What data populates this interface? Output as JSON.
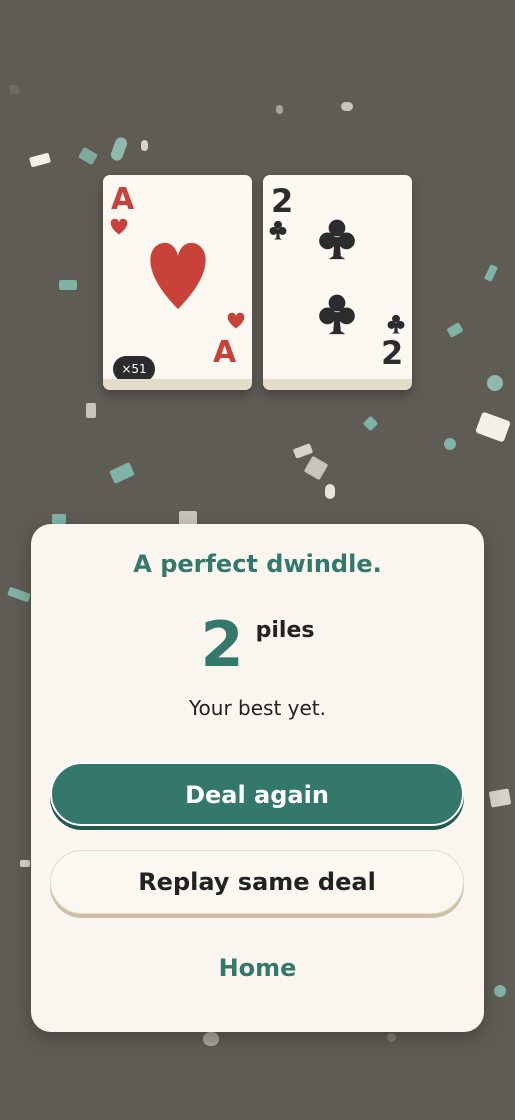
{
  "colors": {
    "background": "#5f5b55",
    "accent": "#33786a",
    "panel": "#faf6ef",
    "card": "#fbf8f1",
    "red_suit": "#c8423a",
    "black_suit": "#2c2c2e"
  },
  "tableau": {
    "cards": [
      {
        "rank": "A",
        "suit": "hearts",
        "suit_icon": "heart-icon",
        "badge": "×51"
      },
      {
        "rank": "2",
        "suit": "clubs",
        "suit_icon": "club-icon"
      }
    ]
  },
  "result": {
    "headline": "A perfect dwindle.",
    "score": "2",
    "score_unit": "piles",
    "subtext": "Your best yet."
  },
  "actions": {
    "deal_again": "Deal again",
    "replay": "Replay same deal",
    "home": "Home"
  }
}
